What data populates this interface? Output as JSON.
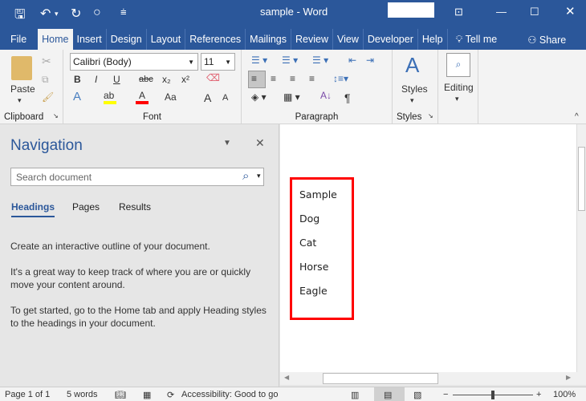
{
  "title": "sample - Word",
  "tabs": [
    "File",
    "Home",
    "Insert",
    "Design",
    "Layout",
    "References",
    "Mailings",
    "Review",
    "View",
    "Developer",
    "Help"
  ],
  "tell_me": "Tell me",
  "share": "Share",
  "ribbon": {
    "paste": "Paste",
    "clipboard": "Clipboard",
    "font_name": "Calibri (Body)",
    "font_size": "11",
    "font": "Font",
    "paragraph": "Paragraph",
    "styles_btn": "Styles",
    "styles": "Styles",
    "editing": "Editing",
    "bold": "B",
    "italic": "I",
    "underline": "U",
    "strike": "abc",
    "sub": "x₂",
    "sup": "x²",
    "case": "Aa",
    "grow": "A",
    "shrink": "A",
    "pilcrow": "¶"
  },
  "nav": {
    "title": "Navigation",
    "search_placeholder": "Search document",
    "tabs": [
      "Headings",
      "Pages",
      "Results"
    ],
    "p1": "Create an interactive outline of your document.",
    "p2": "It's a great way to keep track of where you are or quickly move your content around.",
    "p3": "To get started, go to the Home tab and apply Heading styles to the headings in your document."
  },
  "document": {
    "lines": [
      "Sample",
      "Dog",
      "Cat",
      "Horse",
      "Eagle"
    ],
    "highlight_color": "#ff0000"
  },
  "status": {
    "page": "Page 1 of 1",
    "words": "5 words",
    "accessibility": "Accessibility: Good to go",
    "zoom": "100%",
    "zoom_percent": 100
  },
  "colors": {
    "brand": "#2b579a",
    "highlight": "#ffff00",
    "font_color": "#ff0000"
  }
}
